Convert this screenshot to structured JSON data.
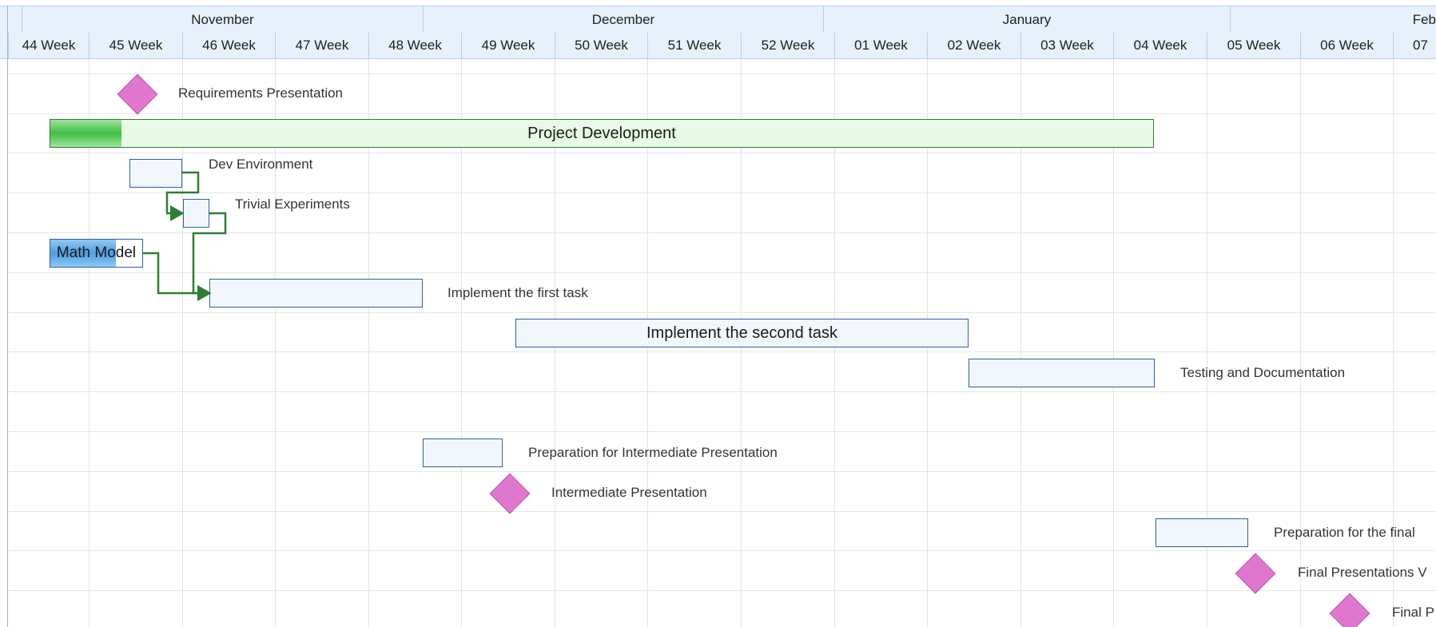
{
  "timeline": {
    "months": [
      "November",
      "December",
      "January",
      "Feb"
    ],
    "weeks": [
      "44 Week",
      "45 Week",
      "46 Week",
      "47 Week",
      "48 Week",
      "49 Week",
      "50 Week",
      "51 Week",
      "52 Week",
      "01 Week",
      "02 Week",
      "03 Week",
      "04 Week",
      "05 Week",
      "06 Week",
      "07"
    ]
  },
  "tasks": {
    "requirements_presentation": {
      "label": "Requirements Presentation",
      "type": "milestone"
    },
    "project_development": {
      "label": "Project Development",
      "type": "summary",
      "progress": 0.07
    },
    "dev_environment": {
      "label": "Dev Environment",
      "type": "task"
    },
    "trivial_experiments": {
      "label": "Trivial Experiments",
      "type": "task"
    },
    "math_model": {
      "label": "Math Model",
      "type": "task",
      "progress": 0.7
    },
    "implement_first": {
      "label": "Implement the first task",
      "type": "task"
    },
    "implement_second": {
      "label": "Implement the second task",
      "type": "task"
    },
    "testing_documentation": {
      "label": "Testing and Documentation",
      "type": "task"
    },
    "prep_intermediate": {
      "label": "Preparation for Intermediate Presentation",
      "type": "task"
    },
    "intermediate_presentation": {
      "label": "Intermediate Presentation",
      "type": "milestone"
    },
    "prep_final": {
      "label": "Preparation for the final",
      "type": "task"
    },
    "final_presentations": {
      "label": "Final Presentations V",
      "type": "milestone"
    },
    "final_last": {
      "label": "Final P",
      "type": "milestone"
    }
  },
  "colors": {
    "task_border": "#2f5fa3",
    "summary_border": "#2e7d32",
    "milestone": "#e077cf",
    "link": "#2e7d32",
    "header_bg": "#e6f1fc"
  }
}
